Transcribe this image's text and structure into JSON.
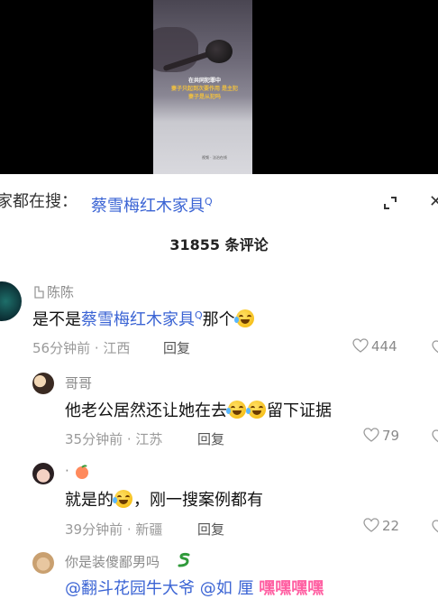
{
  "video": {
    "subtitle_line1": "在共同犯罪中",
    "subtitle_line2": "妻子只起到次要作用 是主犯",
    "subtitle_line3": "妻子是从犯吗",
    "watermark": "视频 · 法治在线"
  },
  "search": {
    "prefix": "家都在搜：",
    "term": "蔡雪梅红木家具",
    "q_mark": "Q"
  },
  "header": {
    "comment_count": "31855 条评论",
    "close_glyph": "✕"
  },
  "comments": [
    {
      "username": "陈陈",
      "text_before": "是不是",
      "search_link": "蔡雪梅红木家具",
      "q_mark": "Q",
      "text_after": "那个",
      "time_location": "56分钟前 · 江西",
      "reply_label": "回复",
      "likes": "444"
    },
    {
      "username": "哥哥",
      "text_before": "他老公居然还让她在去",
      "text_after": "留下证据",
      "time_location": "35分钟前 · 江苏",
      "reply_label": "回复",
      "likes": "79"
    },
    {
      "username": "·",
      "text_before": "就是的",
      "text_after": "，刚一搜案例都有",
      "time_location": "39分钟前 · 新疆",
      "reply_label": "回复",
      "likes": "22"
    },
    {
      "username": "你是装傻鄙男吗",
      "mention1": "@翻斗花园牛大爷",
      "mention2": "@如 厘",
      "pink_text": "嘿嘿嘿嘿"
    }
  ],
  "colors": {
    "link_blue": "#3b64d4",
    "meta_gray": "#9a9a9a",
    "pink": "#ff5fa2"
  }
}
